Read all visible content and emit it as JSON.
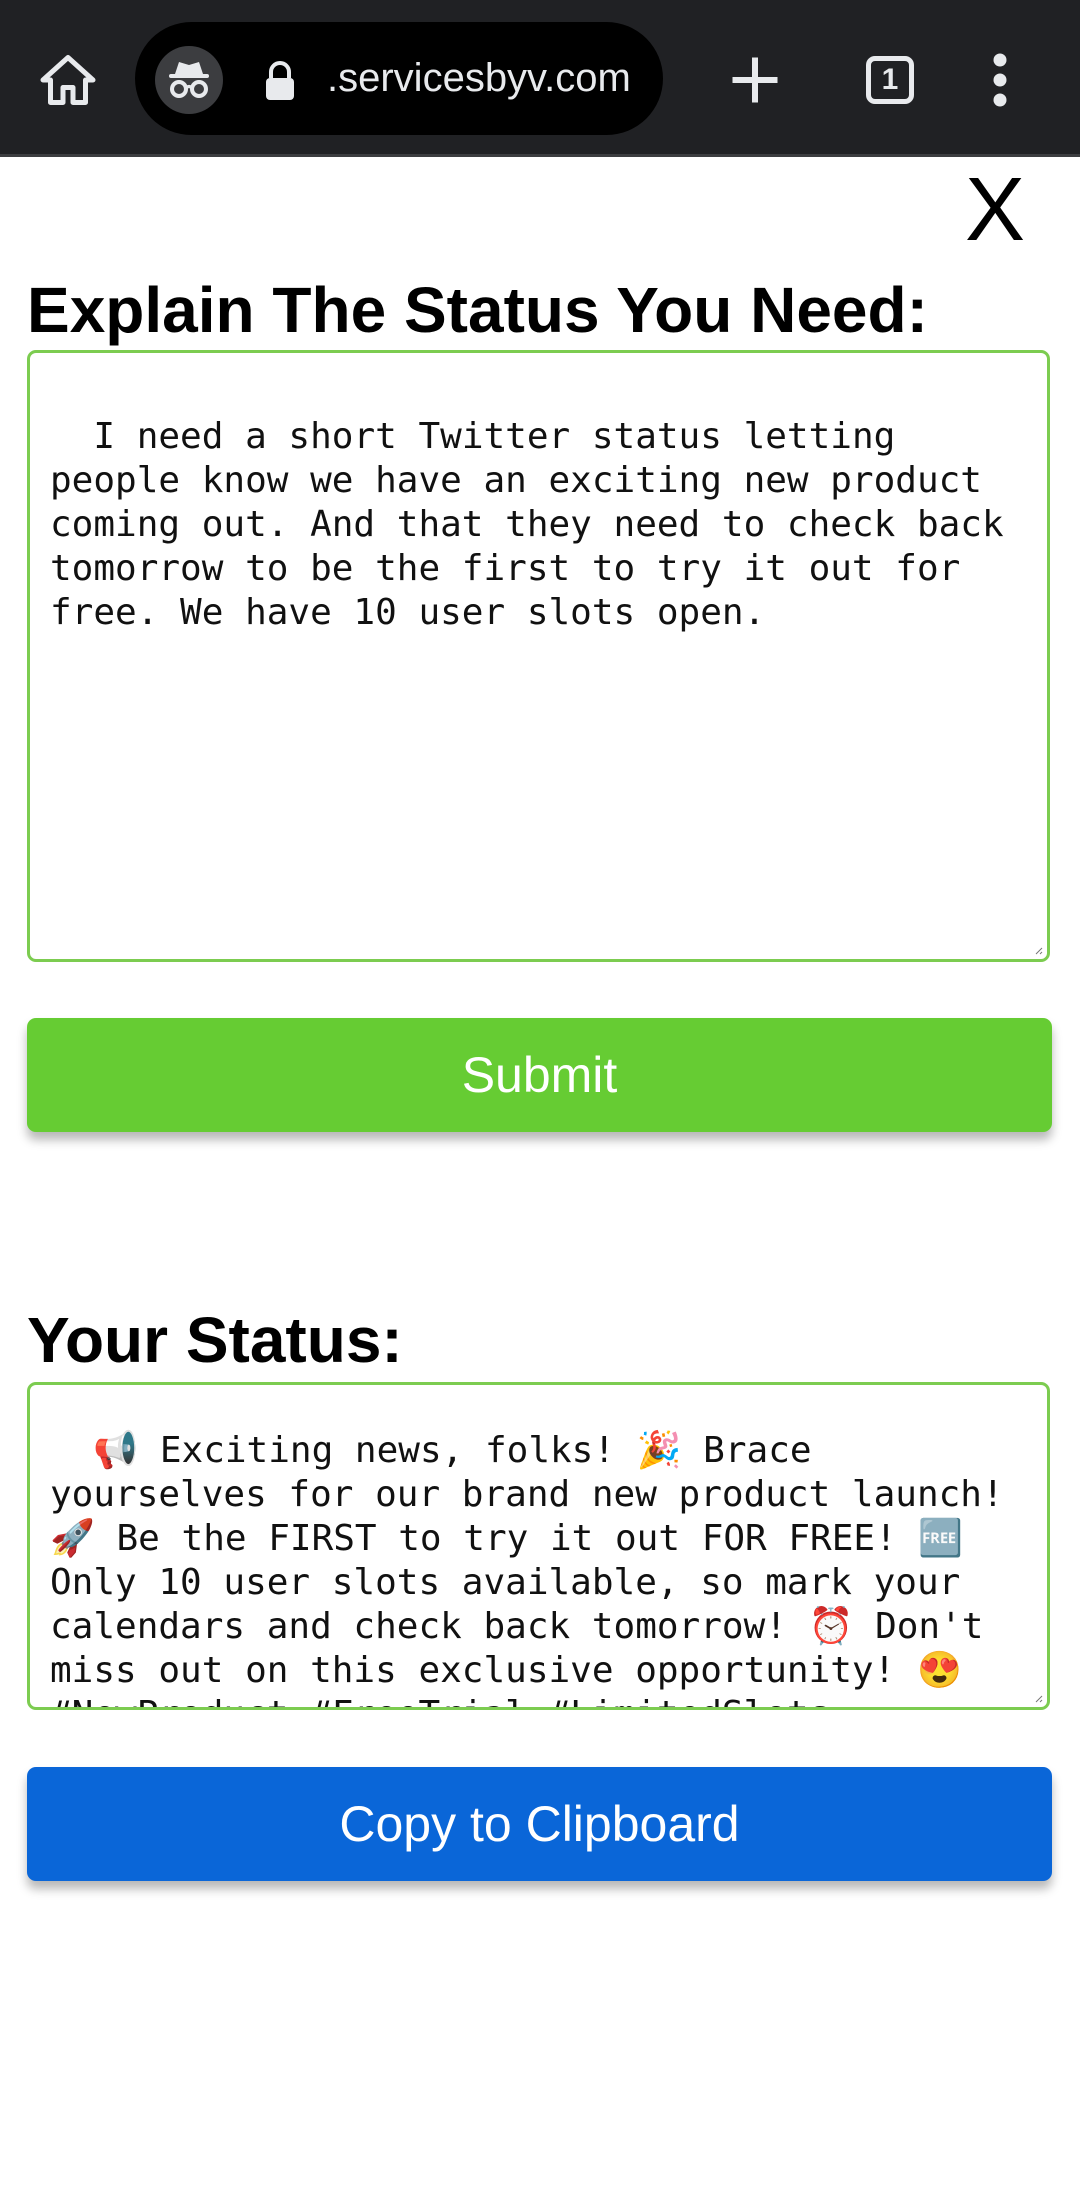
{
  "browser": {
    "url": ".servicesbyv.com",
    "tab_count": "1",
    "icons": [
      "home-icon",
      "incognito-icon",
      "lock-icon",
      "plus-icon",
      "tab-switcher-icon",
      "more-vert-icon"
    ]
  },
  "page": {
    "close_label": "X",
    "prompt_heading": "Explain The Status You Need:",
    "prompt_value": "I need a short Twitter status letting people know we have an exciting new product coming out. And that they need to check back tomorrow to be the first to try it out for free. We have 10 user slots open.",
    "submit_label": "Submit",
    "result_heading": "Your Status:",
    "result_value": "📢 Exciting news, folks! 🎉 Brace yourselves for our brand new product launch! 🚀 Be the FIRST to try it out FOR FREE! 🆓 Only 10 user slots available, so mark your calendars and check back tomorrow! ⏰ Don't miss out on this exclusive opportunity! 😍 #NewProduct #FreeTrial #LimitedSlots",
    "copy_label": "Copy to Clipboard"
  },
  "colors": {
    "submit_bg": "#66cc33",
    "copy_bg": "#0a66d8",
    "textarea_border": "#7ccc50",
    "toolbar_bg": "#202124"
  }
}
